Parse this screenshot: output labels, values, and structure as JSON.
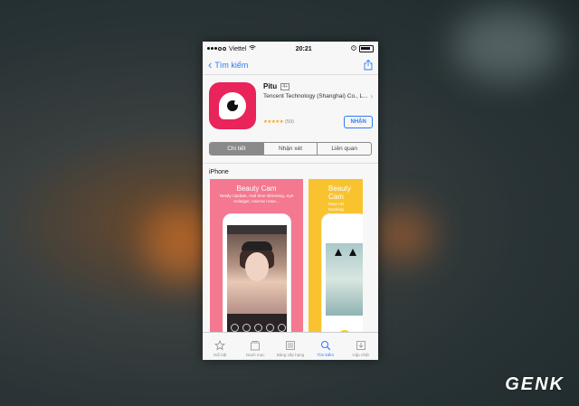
{
  "status_bar": {
    "carrier": "Viettel",
    "time": "20:21"
  },
  "nav": {
    "back_label": "Tìm kiếm",
    "back_icon": "chevron-left-icon",
    "share_icon": "share-icon"
  },
  "app": {
    "name": "Pitu",
    "age_rating": "4+",
    "developer": "Tencent Technology (Shanghai) Co., L...",
    "rating_count": "(59)",
    "stars": 5,
    "get_label": "NHẬN"
  },
  "segments": [
    "Chi tiết",
    "Nhận xét",
    "Liên quan"
  ],
  "active_segment": 0,
  "section": {
    "title": "iPhone"
  },
  "screenshots": [
    {
      "title": "Beauty Cam",
      "subtitle": "Newly Update, real time slimming, eye enlarger, narrow nose..."
    },
    {
      "title": "Beauty Cam",
      "subtitle": "New AR tracking function make your own headdress"
    }
  ],
  "tabbar": [
    {
      "label": "Nổi bật",
      "icon": "star-icon"
    },
    {
      "label": "Danh mục",
      "icon": "categories-icon"
    },
    {
      "label": "Bảng xếp hạng",
      "icon": "list-icon"
    },
    {
      "label": "Tìm kiếm",
      "icon": "search-icon"
    },
    {
      "label": "Cập nhật",
      "icon": "download-icon"
    }
  ],
  "active_tab": 3,
  "watermark": "GENK",
  "colors": {
    "accent": "#2b7cf6",
    "app_icon": "#e8245a",
    "pink": "#f4788f",
    "yellow": "#f9c32f"
  }
}
